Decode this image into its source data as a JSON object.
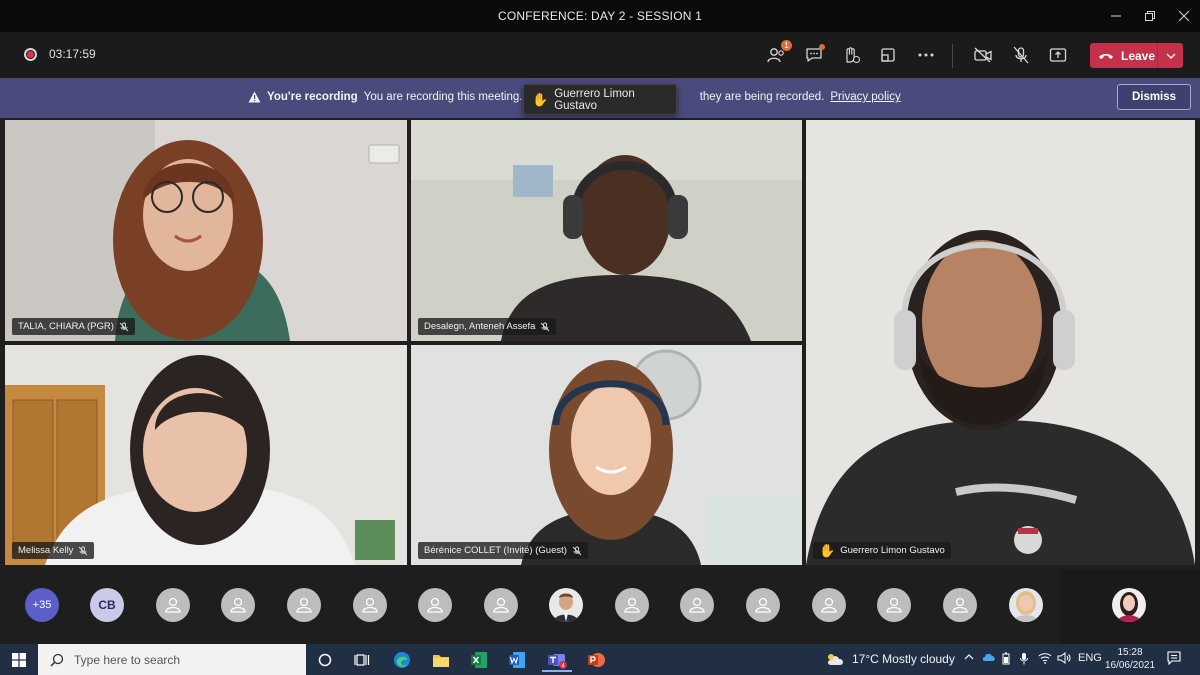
{
  "window": {
    "title": "CONFERENCE: DAY 2 - SESSION 1",
    "controls": [
      "minimize-icon",
      "restore-icon",
      "close-icon"
    ]
  },
  "toolbar": {
    "timer": "03:17:59",
    "participants_badge": "1",
    "leave_label": "Leave"
  },
  "banner": {
    "bold": "You're recording",
    "text_before": "You are recording this meeting. Be",
    "text_after": "they are being recorded.",
    "link": "Privacy policy",
    "dismiss_label": "Dismiss"
  },
  "tooltip": {
    "name": "Guerrero Limon Gustavo"
  },
  "tiles": [
    {
      "name": "TALIA, CHIARA (PGR)",
      "muted": true
    },
    {
      "name": "Desalegn, Anteneh Assefa",
      "muted": true
    },
    {
      "name": "Guerrero Limon Gustavo",
      "muted": false,
      "hand_raised": true
    },
    {
      "name": "Melissa Kelly",
      "muted": true
    },
    {
      "name": "Bérénice COLLET (Invité) (Guest)",
      "muted": true
    }
  ],
  "strip": {
    "more_count": "+35",
    "initials": "CB"
  },
  "taskbar": {
    "search_placeholder": "Type here to search",
    "teams_badge": "4",
    "weather": "17°C  Mostly cloudy",
    "language": "ENG",
    "time": "15:28",
    "date": "16/06/2021"
  },
  "colors": {
    "banner": "#4a4b7c",
    "leave": "#c4314b",
    "more_avatar": "#5b5fc7"
  }
}
